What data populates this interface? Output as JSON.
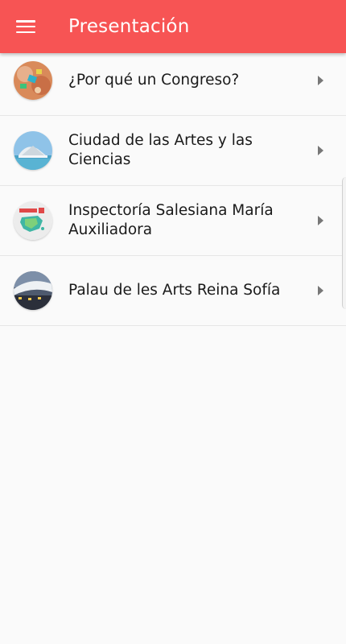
{
  "appbar": {
    "title": "Presentación",
    "menu_icon": "menu-icon",
    "color": "#f75454"
  },
  "list": {
    "items": [
      {
        "label": "¿Por qué un Congreso?",
        "thumb": "hands-puzzle-thumbnail"
      },
      {
        "label": "Ciudad de las Artes y las Ciencias",
        "thumb": "city-arts-sciences-thumbnail"
      },
      {
        "label": "Inspectoría Salesiana María Auxiliadora",
        "thumb": "spain-map-thumbnail"
      },
      {
        "label": "Palau de les Arts Reina Sofía",
        "thumb": "palau-arts-thumbnail"
      }
    ]
  }
}
